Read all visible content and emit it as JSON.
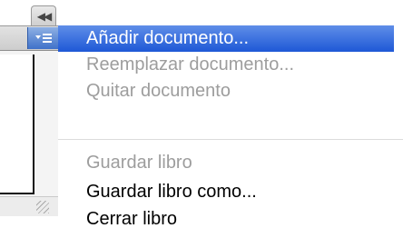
{
  "palette": {
    "collapse_icon": "double-chevron-left-icon",
    "menu_icon": "panel-menu-icon"
  },
  "menu": {
    "items": [
      {
        "label": "Añadir documento...",
        "enabled": true,
        "highlighted": true
      },
      {
        "label": "Reemplazar documento...",
        "enabled": false,
        "highlighted": false
      },
      {
        "label": "Quitar documento",
        "enabled": false,
        "highlighted": false
      },
      {
        "label": "Guardar libro",
        "enabled": false,
        "highlighted": false
      },
      {
        "label": "Guardar libro como...",
        "enabled": true,
        "highlighted": false
      },
      {
        "label": "Cerrar libro",
        "enabled": true,
        "highlighted": false
      }
    ]
  },
  "colors": {
    "highlight_top": "#5f8ee8",
    "highlight_bottom": "#1e58d6",
    "disabled_text": "#9d9d9d",
    "enabled_text": "#000000"
  }
}
